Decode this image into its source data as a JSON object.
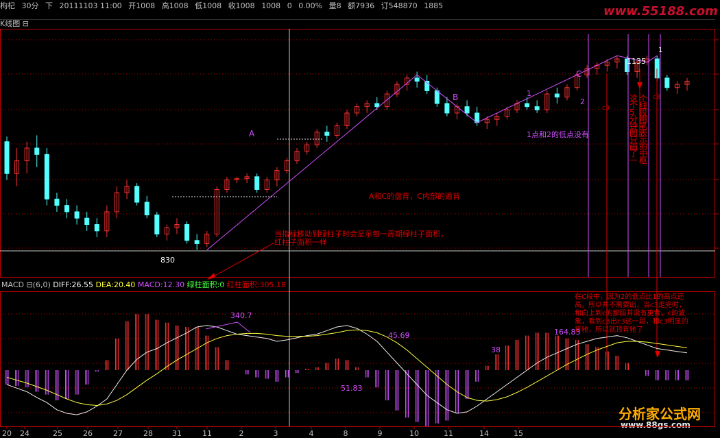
{
  "header": {
    "symbol": "枸杞",
    "period": "30分",
    "direction": "下",
    "datetime": "20111103 11:00",
    "open": "开1008",
    "high": "高1008",
    "low": "低1008",
    "close": "收1008",
    "last": "1008",
    "change": "0",
    "change_pct": "0.00%",
    "volume": "量8",
    "amount": "额7936",
    "orders": "订548870",
    "extra": "1885"
  },
  "main_title": "K线图",
  "collapse_icon": "square-minus-icon",
  "indicator": {
    "name": "MACD",
    "params": "(6,0)",
    "diff": "DIFF:26.55",
    "dea": "DEA:20.40",
    "macd": "MACD:12.30",
    "green_area": "绿柱面积:0",
    "red_area": "红柱面积:305.18"
  },
  "watermark": {
    "top_url": "www.55188.com",
    "bottom_cn": "分析家公式网",
    "bottom_url": "www.88gs.com"
  },
  "colors": {
    "background": "#000000",
    "border": "#c00000",
    "up": "#ff3232",
    "down": "#54ffff",
    "annot": "#e00000",
    "pen": "#d050ff",
    "diff": "#f0f0f0",
    "dea": "#ffff40",
    "macd_pos": "#ff3232",
    "macd_neg": "#d050ff",
    "green": "#40ff40"
  },
  "chart_data": {
    "type": "candlestick",
    "x_tick_labels": [
      "20",
      "24",
      "25",
      "26",
      "27",
      "28",
      "31",
      "11",
      "2",
      "3",
      "4",
      "8",
      "9",
      "10",
      "11",
      "14",
      "15"
    ],
    "price_levels": {
      "low_830": "830",
      "high_1135": "1135"
    },
    "annotations": {
      "A": "A",
      "B": "B",
      "C": "C",
      "pt1": "1",
      "pt2": "2",
      "pt1_top": "1",
      "c3": "c3",
      "c3b": "c3",
      "low830": "830",
      "high1135": "1135",
      "ac_divergence": "A和C的盘背，C内部的遁背",
      "low_points": "1点和2的低点没有",
      "vertical_note": "这个5分钟图只画了一个线段用笔表示的中枢",
      "area_note_1": "当指标移动到绿柱子时会显示每一周期绿柱子面积，",
      "area_note_2": "红柱子面积一样",
      "macd_340": "340.7",
      "macd_45": "45.69",
      "macd_51": "51.83",
      "macd_38": "38",
      "macd_164": "164.83",
      "c_note_1": "在C段中，因为2的低点比1的高点还",
      "c_note_2": "高，所以并不需要出，当c3走完时，",
      "c_note_3": "和向上到c的那段并没有更背，c的波",
      "c_note_4": "象，看到c3出c3这一段，和c3明显的",
      "c_note_5": "背驰，所以就顶背驰了"
    },
    "candles": [
      [
        1000,
        1008,
        940,
        950
      ],
      [
        950,
        990,
        930,
        970
      ],
      [
        970,
        1000,
        950,
        990
      ],
      [
        990,
        1010,
        960,
        980
      ],
      [
        980,
        990,
        900,
        910
      ],
      [
        910,
        920,
        890,
        900
      ],
      [
        900,
        910,
        880,
        890
      ],
      [
        890,
        900,
        870,
        880
      ],
      [
        880,
        890,
        860,
        870
      ],
      [
        870,
        880,
        850,
        860
      ],
      [
        860,
        900,
        850,
        890
      ],
      [
        890,
        930,
        880,
        920
      ],
      [
        920,
        940,
        910,
        930
      ],
      [
        930,
        935,
        900,
        905
      ],
      [
        905,
        915,
        880,
        885
      ],
      [
        885,
        890,
        850,
        855
      ],
      [
        855,
        870,
        845,
        865
      ],
      [
        865,
        880,
        855,
        870
      ],
      [
        870,
        875,
        840,
        845
      ],
      [
        845,
        855,
        830,
        840
      ],
      [
        840,
        860,
        835,
        855
      ],
      [
        855,
        930,
        850,
        925
      ],
      [
        925,
        945,
        920,
        940
      ],
      [
        940,
        945,
        935,
        942
      ],
      [
        942,
        950,
        935,
        945
      ],
      [
        945,
        950,
        920,
        925
      ],
      [
        925,
        945,
        920,
        940
      ],
      [
        940,
        960,
        930,
        955
      ],
      [
        955,
        975,
        950,
        970
      ],
      [
        970,
        990,
        965,
        985
      ],
      [
        985,
        1000,
        980,
        995
      ],
      [
        995,
        1020,
        990,
        1015
      ],
      [
        1015,
        1025,
        1000,
        1010
      ],
      [
        1010,
        1030,
        1005,
        1025
      ],
      [
        1025,
        1050,
        1020,
        1045
      ],
      [
        1045,
        1060,
        1040,
        1055
      ],
      [
        1055,
        1065,
        1045,
        1060
      ],
      [
        1060,
        1070,
        1050,
        1055
      ],
      [
        1055,
        1080,
        1050,
        1075
      ],
      [
        1075,
        1095,
        1070,
        1090
      ],
      [
        1090,
        1105,
        1080,
        1100
      ],
      [
        1100,
        1110,
        1085,
        1095
      ],
      [
        1095,
        1105,
        1075,
        1080
      ],
      [
        1080,
        1085,
        1055,
        1060
      ],
      [
        1060,
        1070,
        1040,
        1045
      ],
      [
        1045,
        1060,
        1035,
        1055
      ],
      [
        1055,
        1065,
        1040,
        1045
      ],
      [
        1045,
        1055,
        1025,
        1030
      ],
      [
        1030,
        1040,
        1020,
        1035
      ],
      [
        1035,
        1045,
        1025,
        1040
      ],
      [
        1040,
        1055,
        1035,
        1050
      ],
      [
        1050,
        1065,
        1045,
        1060
      ],
      [
        1060,
        1070,
        1050,
        1055
      ],
      [
        1055,
        1065,
        1045,
        1050
      ],
      [
        1050,
        1080,
        1045,
        1075
      ],
      [
        1075,
        1085,
        1060,
        1070
      ],
      [
        1070,
        1090,
        1065,
        1085
      ],
      [
        1085,
        1110,
        1080,
        1105
      ],
      [
        1105,
        1120,
        1100,
        1115
      ],
      [
        1115,
        1125,
        1105,
        1120
      ],
      [
        1120,
        1130,
        1110,
        1125
      ],
      [
        1125,
        1135,
        1115,
        1130
      ],
      [
        1130,
        1135,
        1105,
        1110
      ],
      [
        1110,
        1130,
        1100,
        1125
      ],
      [
        1125,
        1135,
        1120,
        1130
      ],
      [
        1130,
        1135,
        1095,
        1100
      ],
      [
        1100,
        1105,
        1080,
        1085
      ],
      [
        1085,
        1095,
        1075,
        1090
      ],
      [
        1090,
        1100,
        1080,
        1095
      ]
    ],
    "diff": [
      -20,
      -25,
      -30,
      -38,
      -45,
      -55,
      -60,
      -62,
      -58,
      -50,
      -40,
      -20,
      0,
      15,
      25,
      30,
      38,
      45,
      52,
      60,
      62,
      60,
      55,
      50,
      48,
      46,
      44,
      40,
      42,
      45,
      48,
      50,
      55,
      60,
      62,
      58,
      50,
      40,
      25,
      10,
      -5,
      -20,
      -35,
      -45,
      -55,
      -60,
      -58,
      -50,
      -40,
      -30,
      -20,
      -10,
      0,
      10,
      18,
      24,
      30,
      36,
      40,
      44,
      46,
      48,
      45,
      40,
      35,
      30,
      28,
      26,
      24
    ],
    "dea": [
      -10,
      -14,
      -18,
      -23,
      -28,
      -34,
      -40,
      -45,
      -48,
      -49,
      -47,
      -42,
      -34,
      -24,
      -14,
      -5,
      5,
      14,
      22,
      30,
      38,
      44,
      48,
      50,
      51,
      51,
      50,
      48,
      47,
      47,
      47,
      48,
      50,
      52,
      55,
      56,
      55,
      52,
      46,
      38,
      28,
      16,
      4,
      -8,
      -20,
      -30,
      -38,
      -42,
      -43,
      -41,
      -37,
      -31,
      -24,
      -16,
      -8,
      0,
      8,
      15,
      22,
      28,
      33,
      38,
      40,
      40,
      39,
      37,
      35,
      33,
      31
    ],
    "macd": [
      -20,
      -22,
      -24,
      -30,
      -34,
      -42,
      -40,
      -34,
      -20,
      -2,
      14,
      44,
      68,
      78,
      78,
      70,
      66,
      62,
      60,
      60,
      48,
      32,
      14,
      0,
      -6,
      -10,
      -12,
      -16,
      -10,
      -4,
      2,
      4,
      10,
      16,
      14,
      4,
      -10,
      -24,
      -42,
      -56,
      -66,
      -72,
      -78,
      -74,
      -70,
      -60,
      -40,
      -16,
      6,
      22,
      34,
      42,
      48,
      52,
      52,
      48,
      44,
      42,
      36,
      32,
      26,
      20,
      10,
      0,
      -8,
      -14,
      -14,
      -14,
      -14
    ]
  }
}
